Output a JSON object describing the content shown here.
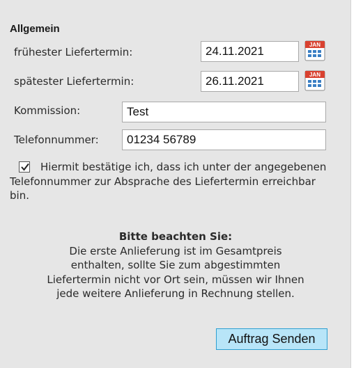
{
  "section": {
    "title": "Allgemein"
  },
  "fields": {
    "earliest": {
      "label": "frühester Liefertermin:",
      "value": "24.11.2021"
    },
    "latest": {
      "label": "spätester Liefertermin:",
      "value": "26.11.2021"
    },
    "commission": {
      "label": "Kommission:",
      "value": "Test"
    },
    "phone": {
      "label": "Telefonnummer:",
      "value": "01234 56789"
    }
  },
  "calendar": {
    "header": "JAN",
    "icon": "calendar-icon"
  },
  "confirm": {
    "checked": true,
    "text": "Hiermit bestätige ich, dass ich unter der angegebenen Telefonnummer zur Absprache des Liefertermin erreichbar bin."
  },
  "notice": {
    "title": "Bitte beachten Sie:",
    "lines": [
      "Die erste Anlieferung ist im Gesamtpreis",
      "enthalten, sollte Sie zum abgestimmten",
      "Liefertermin nicht vor Ort sein, müssen wir Ihnen",
      "jede weitere Anlieferung in Rechnung stellen."
    ]
  },
  "submit": {
    "label": "Auftrag Senden"
  },
  "colors": {
    "panel": "#e6e6e6",
    "button_bg": "#b8e5f8",
    "button_border": "#2e9fd1",
    "calendar_red": "#d9412f",
    "calendar_blue": "#3a7fc4"
  }
}
